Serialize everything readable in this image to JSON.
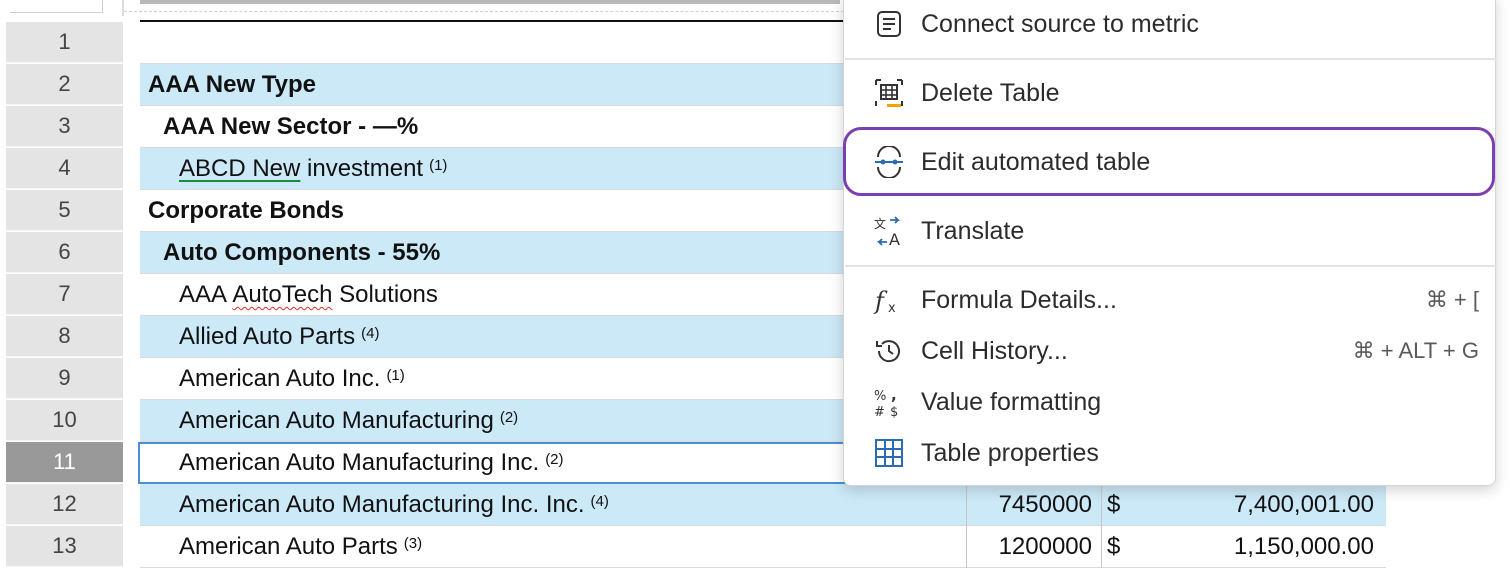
{
  "row_numbers": [
    "1",
    "2",
    "3",
    "4",
    "5",
    "6",
    "7",
    "8",
    "9",
    "10",
    "11",
    "12",
    "13"
  ],
  "rows": {
    "r2": {
      "name": "AAA New Type"
    },
    "r3": {
      "name": "AAA New Sector - —%"
    },
    "r4": {
      "name_a": "ABCD New",
      "name_b": " investment",
      "note": "(1)"
    },
    "r5": {
      "name": "Corporate Bonds"
    },
    "r6": {
      "name": "Auto Components - 55%"
    },
    "r7": {
      "name_a": "AAA ",
      "name_b": "AutoTech",
      "name_c": " Solutions"
    },
    "r8": {
      "name": "Allied Auto Parts",
      "note": "(4)"
    },
    "r9": {
      "name": "American Auto Inc.",
      "note": "(1)"
    },
    "r10": {
      "name": "American Auto Manufacturing",
      "note": "(2)"
    },
    "r11": {
      "name": "American Auto Manufacturing Inc.",
      "note": "(2)"
    },
    "r12": {
      "name": "American Auto Manufacturing Inc. Inc.",
      "note": "(4)",
      "qty": "7450000",
      "currency": "$",
      "value": "7,400,001.00"
    },
    "r13": {
      "name": "American Auto Parts",
      "note": "(3)",
      "qty": "1200000",
      "currency": "$",
      "value": "1,150,000.00"
    }
  },
  "menu": {
    "connect_source": "Connect source to metric",
    "delete_table": "Delete Table",
    "edit_automated_table": "Edit automated table",
    "translate": "Translate",
    "formula_details": "Formula Details...",
    "formula_details_shortcut": "⌘ + [",
    "cell_history": "Cell History...",
    "cell_history_shortcut": "⌘ + ALT + G",
    "value_formatting": "Value formatting",
    "table_properties": "Table properties"
  },
  "colors": {
    "row_highlight": "#cce9f8",
    "highlight_border": "#7b3fb2",
    "selected_cell_border": "#4a90d9",
    "accent_icon": "#2b6cb0",
    "delete_icon_accent": "#f0a500"
  },
  "icons": {
    "connect_source": "list-document-icon",
    "delete_table": "grid-delete-icon",
    "edit_automated_table": "node-link-icon",
    "translate": "translate-icon",
    "formula_details": "function-icon",
    "cell_history": "history-clock-icon",
    "value_formatting": "percent-hash-icon",
    "table_properties": "table-grid-icon"
  }
}
